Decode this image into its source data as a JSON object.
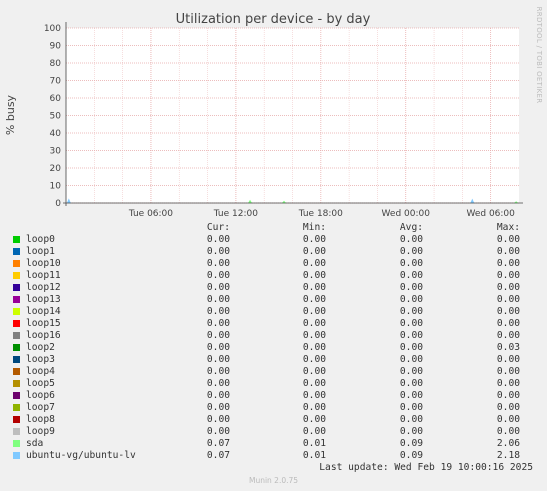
{
  "chart_data": {
    "type": "area",
    "title": "Utilization per device - by day",
    "ylabel": "% busy",
    "ylim": [
      0,
      100
    ],
    "yticks": [
      0,
      10,
      20,
      30,
      40,
      50,
      60,
      70,
      80,
      90,
      100
    ],
    "xticks": [
      "Tue 06:00",
      "Tue 12:00",
      "Tue 18:00",
      "Wed 00:00",
      "Wed 06:00"
    ],
    "xlim_hours": [
      0,
      32
    ],
    "xtick_hours": [
      6,
      12,
      18,
      24,
      30
    ],
    "spikes": [
      {
        "series": "ubuntu-vg/ubuntu-lv",
        "hour": 0.2,
        "value": 2.2
      },
      {
        "series": "sda",
        "hour": 13.0,
        "value": 1.5
      },
      {
        "series": "sda",
        "hour": 15.4,
        "value": 1.0
      },
      {
        "series": "ubuntu-vg/ubuntu-lv",
        "hour": 28.7,
        "value": 2.1
      },
      {
        "series": "sda",
        "hour": 31.8,
        "value": 0.8
      }
    ],
    "grid": true
  },
  "side_label": "RRDTOOL / TOBI OETIKER",
  "legend": {
    "headers": {
      "cur": "Cur:",
      "min": "Min:",
      "avg": "Avg:",
      "max": "Max:"
    },
    "rows": [
      {
        "name": "loop0",
        "color": "#00cc00",
        "cur": "0.00",
        "min": "0.00",
        "avg": "0.00",
        "max": "0.00"
      },
      {
        "name": "loop1",
        "color": "#0066b3",
        "cur": "0.00",
        "min": "0.00",
        "avg": "0.00",
        "max": "0.00"
      },
      {
        "name": "loop10",
        "color": "#ff8000",
        "cur": "0.00",
        "min": "0.00",
        "avg": "0.00",
        "max": "0.00"
      },
      {
        "name": "loop11",
        "color": "#ffcc00",
        "cur": "0.00",
        "min": "0.00",
        "avg": "0.00",
        "max": "0.00"
      },
      {
        "name": "loop12",
        "color": "#330099",
        "cur": "0.00",
        "min": "0.00",
        "avg": "0.00",
        "max": "0.00"
      },
      {
        "name": "loop13",
        "color": "#990099",
        "cur": "0.00",
        "min": "0.00",
        "avg": "0.00",
        "max": "0.00"
      },
      {
        "name": "loop14",
        "color": "#ccff00",
        "cur": "0.00",
        "min": "0.00",
        "avg": "0.00",
        "max": "0.00"
      },
      {
        "name": "loop15",
        "color": "#ff0000",
        "cur": "0.00",
        "min": "0.00",
        "avg": "0.00",
        "max": "0.00"
      },
      {
        "name": "loop16",
        "color": "#808080",
        "cur": "0.00",
        "min": "0.00",
        "avg": "0.00",
        "max": "0.00"
      },
      {
        "name": "loop2",
        "color": "#008f00",
        "cur": "0.00",
        "min": "0.00",
        "avg": "0.00",
        "max": "0.03"
      },
      {
        "name": "loop3",
        "color": "#00487d",
        "cur": "0.00",
        "min": "0.00",
        "avg": "0.00",
        "max": "0.00"
      },
      {
        "name": "loop4",
        "color": "#b35a00",
        "cur": "0.00",
        "min": "0.00",
        "avg": "0.00",
        "max": "0.00"
      },
      {
        "name": "loop5",
        "color": "#b38f00",
        "cur": "0.00",
        "min": "0.00",
        "avg": "0.00",
        "max": "0.00"
      },
      {
        "name": "loop6",
        "color": "#6b006b",
        "cur": "0.00",
        "min": "0.00",
        "avg": "0.00",
        "max": "0.00"
      },
      {
        "name": "loop7",
        "color": "#8fb300",
        "cur": "0.00",
        "min": "0.00",
        "avg": "0.00",
        "max": "0.00"
      },
      {
        "name": "loop8",
        "color": "#b30000",
        "cur": "0.00",
        "min": "0.00",
        "avg": "0.00",
        "max": "0.00"
      },
      {
        "name": "loop9",
        "color": "#bebebe",
        "cur": "0.00",
        "min": "0.00",
        "avg": "0.00",
        "max": "0.00"
      },
      {
        "name": "sda",
        "color": "#80ff80",
        "cur": "0.07",
        "min": "0.01",
        "avg": "0.09",
        "max": "2.06"
      },
      {
        "name": "ubuntu-vg/ubuntu-lv",
        "color": "#80c9ff",
        "cur": "0.07",
        "min": "0.01",
        "avg": "0.09",
        "max": "2.18"
      }
    ]
  },
  "last_update": "Last update: Wed Feb 19 10:00:16 2025",
  "footer": "Munin 2.0.75"
}
